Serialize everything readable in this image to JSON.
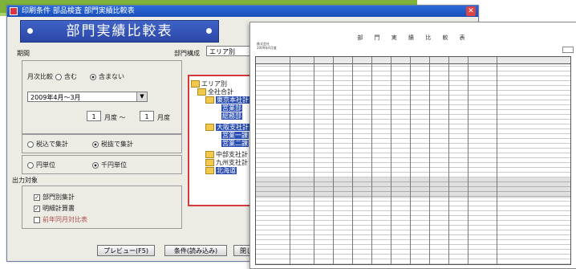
{
  "window": {
    "title": "印刷条件 部品検査 部門実績比較表"
  },
  "banner": {
    "title": "部門実績比較表"
  },
  "period": {
    "label": "期間",
    "compare_label": "月次比較",
    "opt_include": "含む",
    "opt_exclude": "含まない",
    "year_value": "2009年4月〜3月",
    "from_month": "1",
    "month_sep": "月度 〜",
    "to_month": "1",
    "month_suffix": "月度"
  },
  "aggregation": {
    "opt_a": "税込で集計",
    "opt_b": "税抜で集計"
  },
  "units": {
    "opt_a": "円単位",
    "opt_b": "千円単位"
  },
  "output": {
    "label": "出力対象",
    "item1": "部門別集計",
    "item2": "明細計算書",
    "item3": "前年同月対比表"
  },
  "dept": {
    "label": "部門構成",
    "selector_value": "エリア別",
    "tree": [
      "エリア別",
      "全社合計",
      "東京本社計",
      "営業部",
      "総務部",
      "大阪支社計",
      "営業一課",
      "営業二課",
      "中部支社計",
      "九州支社計",
      "北海道"
    ]
  },
  "buttons": {
    "preview": "プレビュー(F5)",
    "condition": "条件(読み込み)",
    "close": "閉じる"
  },
  "report": {
    "title": "部 門 実 績 比 較 表",
    "meta1": "株式会社",
    "meta2": "2009年4月度"
  }
}
